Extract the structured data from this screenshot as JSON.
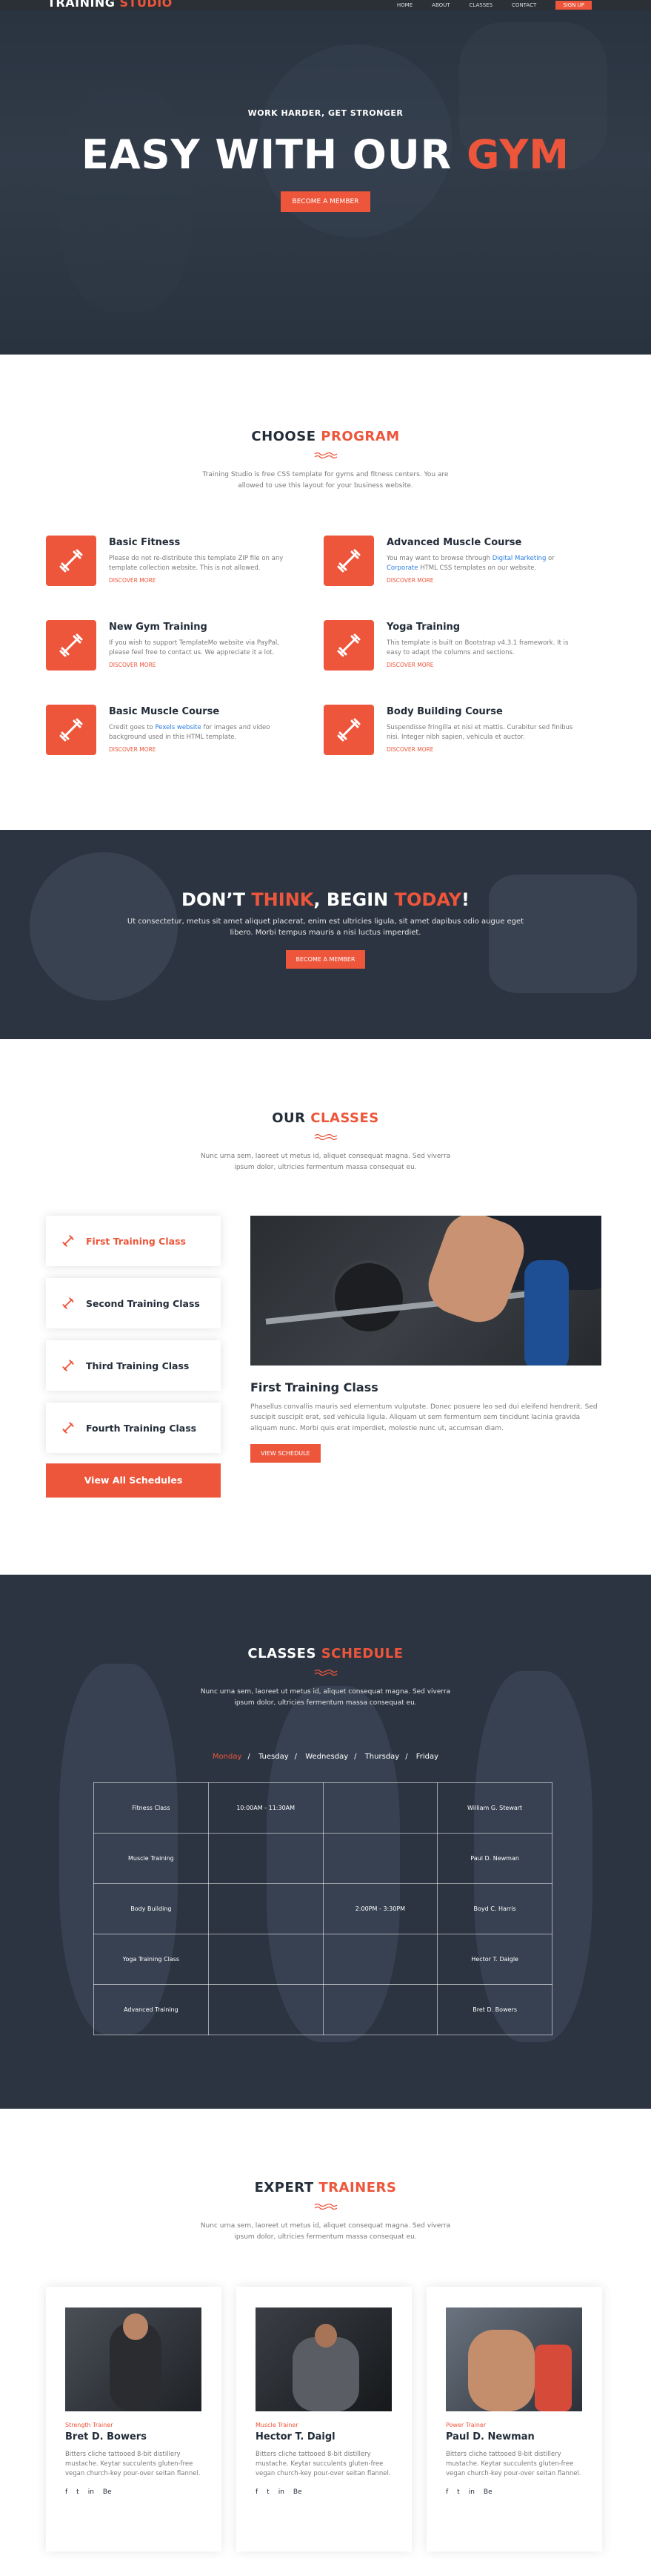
{
  "header": {
    "logo_main": "TRAINING",
    "logo_accent": "STUDIO",
    "nav": [
      "HOME",
      "ABOUT",
      "CLASSES",
      "CONTACT"
    ],
    "nav_cta": "SIGN UP"
  },
  "hero": {
    "kicker": "WORK HARDER, GET STRONGER",
    "title_main": "EASY WITH OUR",
    "title_accent": "GYM",
    "button": "BECOME A MEMBER"
  },
  "program": {
    "title_main": "CHOOSE",
    "title_accent": "PROGRAM",
    "subtitle": "Training Studio is free CSS template for gyms and fitness centers. You are allowed to use this layout for your business website.",
    "features": [
      {
        "title": "Basic Fitness",
        "text": "Please do not re-distribute this template ZIP file on any template collection website. This is not allowed.",
        "more": "DISCOVER MORE"
      },
      {
        "title": "Advanced Muscle Course",
        "text_before": "You may want to browse through ",
        "link1": "Digital Marketing",
        "text_mid": " or ",
        "link2": "Corporate",
        "text_after": " HTML CSS templates on our website.",
        "more": "DISCOVER MORE"
      },
      {
        "title": "New Gym Training",
        "text": "If you wish to support TemplateMo website via PayPal, please feel free to contact us. We appreciate it a lot.",
        "more": "DISCOVER MORE"
      },
      {
        "title": "Yoga Training",
        "text": "This template is built on Bootstrap v4.3.1 framework. It is easy to adapt the columns and sections.",
        "more": "DISCOVER MORE"
      },
      {
        "title": "Basic Muscle Course",
        "text_before": "Credit goes to ",
        "link1": "Pexels website",
        "text_after": " for images and video background used in this HTML template.",
        "more": "DISCOVER MORE"
      },
      {
        "title": "Body Building Course",
        "text": "Suspendisse fringilla et nisi et mattis. Curabitur sed finibus nisi. Integer nibh sapien, vehicula et auctor.",
        "more": "DISCOVER MORE"
      }
    ]
  },
  "cta": {
    "t1": "DON’T",
    "t2": "THINK",
    "t3": ", BEGIN",
    "t4": "TODAY",
    "t5": "!",
    "text": "Ut consectetur, metus sit amet aliquet placerat, enim est ultricies ligula, sit amet dapibus odio augue eget libero. Morbi tempus mauris a nisi luctus imperdiet.",
    "button": "BECOME A MEMBER"
  },
  "classes": {
    "title_main": "OUR",
    "title_accent": "CLASSES",
    "subtitle": "Nunc urna sem, laoreet ut metus id, aliquet consequat magna. Sed viverra ipsum dolor, ultricies fermentum massa consequat eu.",
    "tabs": [
      "First Training Class",
      "Second Training Class",
      "Third Training Class",
      "Fourth Training Class"
    ],
    "view_all": "View All Schedules",
    "active_title": "First Training Class",
    "active_text": "Phasellus convallis mauris sed elementum vulputate. Donec posuere leo sed dui eleifend hendrerit. Sed suscipit suscipit erat, sed vehicula ligula. Aliquam ut sem fermentum sem tincidunt lacinia gravida aliquam nunc. Morbi quis erat imperdiet, molestie nunc ut, accumsan diam.",
    "active_button": "VIEW SCHEDULE"
  },
  "schedule": {
    "title_main": "CLASSES",
    "title_accent": "SCHEDULE",
    "subtitle": "Nunc urna sem, laoreet ut metus id, aliquet consequat magna. Sed viverra ipsum dolor, ultricies fermentum massa consequat eu.",
    "days": [
      "Monday",
      "Tuesday",
      "Wednesday",
      "Thursday",
      "Friday"
    ],
    "rows": [
      [
        "Fitness Class",
        "10:00AM - 11:30AM",
        "",
        "William G. Stewart"
      ],
      [
        "Muscle Training",
        "",
        "",
        "Paul D. Newman"
      ],
      [
        "Body Building",
        "",
        "2:00PM - 3:30PM",
        "Boyd C. Harris"
      ],
      [
        "Yoga Training Class",
        "",
        "",
        "Hector T. Daigle"
      ],
      [
        "Advanced Training",
        "",
        "",
        "Bret D. Bowers"
      ]
    ]
  },
  "trainers": {
    "title_main": "EXPERT",
    "title_accent": "TRAINERS",
    "subtitle": "Nunc urna sem, laoreet ut metus id, aliquet consequat magna. Sed viverra ipsum dolor, ultricies fermentum massa consequat eu.",
    "cards": [
      {
        "role": "Strength Trainer",
        "name": "Bret D. Bowers",
        "text": "Bitters cliche tattooed 8-bit distillery mustache. Keytar succulents gluten-free vegan church-key pour-over seitan flannel."
      },
      {
        "role": "Muscle Trainer",
        "name": "Hector T. Daigl",
        "text": "Bitters cliche tattooed 8-bit distillery mustache. Keytar succulents gluten-free vegan church-key pour-over seitan flannel."
      },
      {
        "role": "Power Trainer",
        "name": "Paul D. Newman",
        "text": "Bitters cliche tattooed 8-bit distillery mustache. Keytar succulents gluten-free vegan church-key pour-over seitan flannel."
      }
    ],
    "social": [
      "f",
      "t",
      "in",
      "Be"
    ]
  },
  "icons": {
    "feature_icon": "dumbbell-icon",
    "heading_line": "wave-line-icon"
  }
}
